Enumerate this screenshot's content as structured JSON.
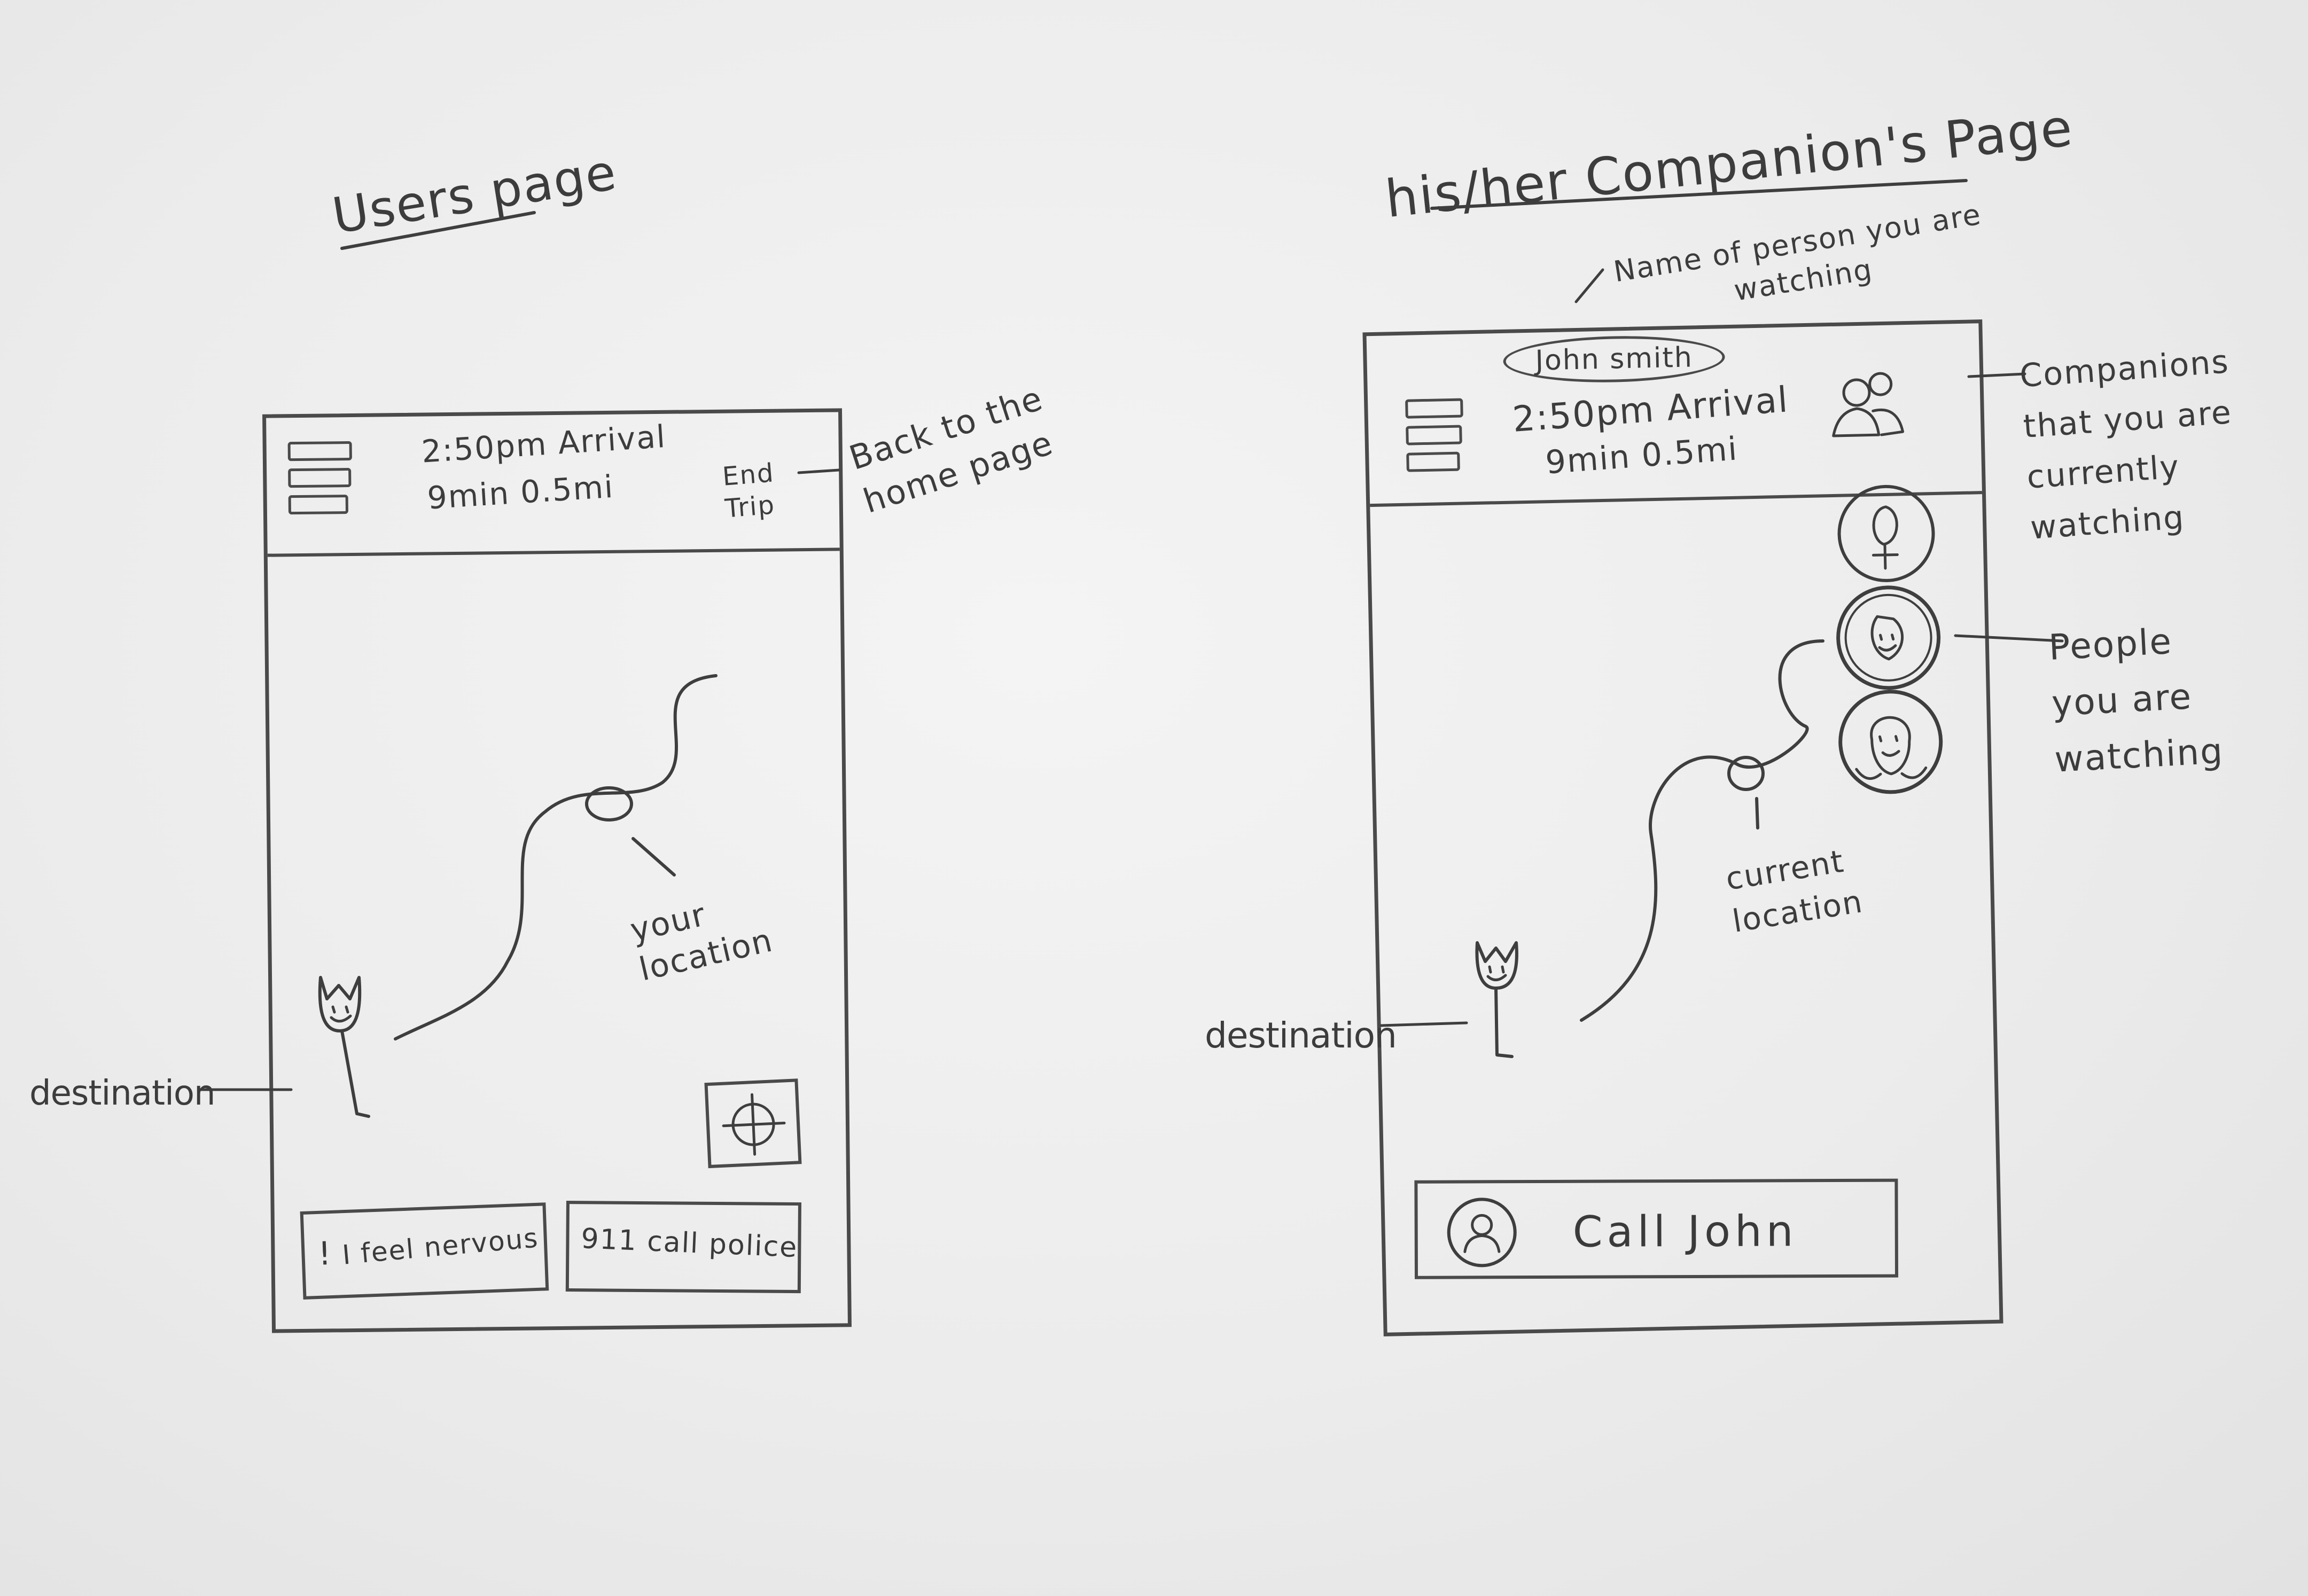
{
  "left_sketch": {
    "title": "Users page",
    "header": {
      "arrival": "2:50pm Arrival",
      "trip_info": "9min 0.5mi",
      "end_trip_label": "End Trip"
    },
    "annotations": {
      "end_trip_note": "Back to the home page",
      "location_note": "your location",
      "destination_note": "destination"
    },
    "buttons": {
      "nervous_icon": "!",
      "nervous_label": "I feel nervous",
      "police_label": "911 call police"
    },
    "icons": [
      "menu-icon",
      "crosshair-icon",
      "destination-flag-icon",
      "location-pin-icon"
    ]
  },
  "right_sketch": {
    "title": "his/her Companion's Page",
    "header": {
      "person_name": "John smith",
      "arrival": "2:50pm Arrival",
      "trip_info": "9min 0.5mi"
    },
    "annotations": {
      "name_note": "Name of person you are watching",
      "companions_note": "Companions that you are currently watching",
      "people_note": "People you are watching",
      "location_note": "current location",
      "destination_note": "destination"
    },
    "buttons": {
      "call_label": "Call John"
    },
    "icons": [
      "menu-icon",
      "companions-icon",
      "avatar-icon",
      "destination-flag-icon",
      "location-pin-icon"
    ]
  }
}
